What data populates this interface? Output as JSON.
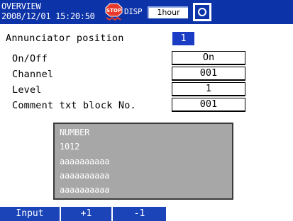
{
  "header": {
    "title": "OVERVIEW",
    "datetime": "2008/12/01 15:20:50",
    "stop_icon": "stop-alarm-icon",
    "stop_text": "STOP",
    "disp_label": "DISP",
    "rate": "1hour",
    "media_icon": "media-icon"
  },
  "settings": {
    "annunciator_label": "Annunciator position",
    "annunciator_value": "1",
    "onoff_label": "On/Off",
    "onoff_value": "On",
    "channel_label": "Channel",
    "channel_value": "001",
    "level_label": "Level",
    "level_value": "1",
    "comment_label": "Comment txt block No.",
    "comment_value": "001"
  },
  "preview": {
    "lines": [
      "NUMBER",
      "1012",
      "aaaaaaaaaa",
      "aaaaaaaaaa",
      "aaaaaaaaaa"
    ]
  },
  "softkeys": {
    "input": "Input",
    "plus": "+1",
    "minus": "-1"
  },
  "colors": {
    "header_bg": "#0c33a8",
    "selected_bg": "#1b3dc6",
    "softkey_bg": "#1a44b8",
    "preview_bg": "#a7a7a7"
  }
}
